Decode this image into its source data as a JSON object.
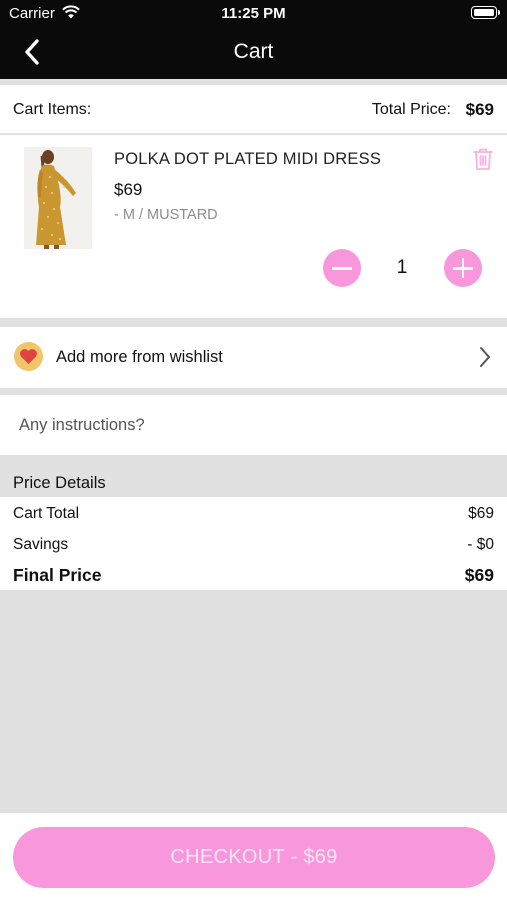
{
  "status_bar": {
    "carrier": "Carrier",
    "time": "11:25 PM"
  },
  "nav": {
    "title": "Cart"
  },
  "summary": {
    "cart_items_label": "Cart Items:",
    "total_price_label": "Total Price:",
    "total_price_value": "$69"
  },
  "item": {
    "name": "POLKA DOT PLATED MIDI DRESS",
    "price": "$69",
    "variant": "- M / MUSTARD",
    "quantity": "1"
  },
  "wishlist": {
    "label": "Add more from wishlist"
  },
  "instructions": {
    "placeholder": "Any instructions?",
    "value": ""
  },
  "price_details": {
    "title": "Price Details",
    "rows": [
      {
        "label": "Cart Total",
        "value": "$69"
      },
      {
        "label": "Savings",
        "value": "- $0"
      },
      {
        "label": "Final Price",
        "value": "$69"
      }
    ]
  },
  "checkout": {
    "label": "CHECKOUT - $69"
  },
  "colors": {
    "accent": "#f997dd",
    "nav_bg": "#0a0a0a",
    "section_bg": "#e1e1e1",
    "wishlist_icon_bg": "#f3c56a",
    "heart": "#e2433d",
    "product_dress": "#c9962f"
  },
  "icons": [
    "wifi-icon",
    "battery-icon",
    "back-arrow-icon",
    "trash-icon",
    "minus-icon",
    "plus-icon",
    "heart-icon",
    "chevron-right-icon"
  ]
}
